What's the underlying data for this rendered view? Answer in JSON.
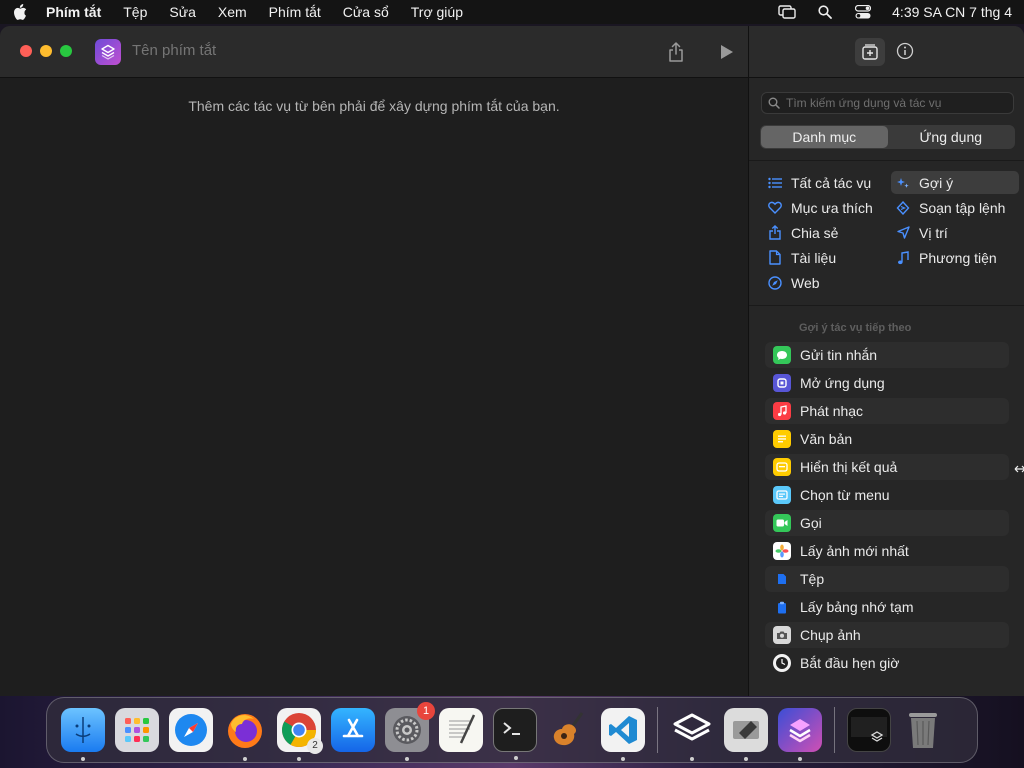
{
  "menubar": {
    "app_name": "Phím tắt",
    "items": [
      "Tệp",
      "Sửa",
      "Xem",
      "Phím tắt",
      "Cửa sổ",
      "Trợ giúp"
    ],
    "clock": "4:39 SA CN 7 thg 4"
  },
  "editor": {
    "title_placeholder": "Tên phím tắt",
    "hint": "Thêm các tác vụ từ bên phải để xây dựng phím tắt của bạn."
  },
  "sidebar": {
    "search_placeholder": "Tìm kiếm ứng dụng và tác vụ",
    "segments": [
      "Danh mục",
      "Ứng dụng"
    ],
    "categories_left": [
      {
        "label": "Tất cả tác vụ",
        "icon": "list-icon",
        "color": "#4a90ff"
      },
      {
        "label": "Mục ưa thích",
        "icon": "heart-icon",
        "color": "#4a90ff"
      },
      {
        "label": "Chia sẻ",
        "icon": "share-icon",
        "color": "#4a90ff"
      },
      {
        "label": "Tài liệu",
        "icon": "document-icon",
        "color": "#4a90ff"
      },
      {
        "label": "Web",
        "icon": "compass-icon",
        "color": "#4a90ff"
      }
    ],
    "categories_right": [
      {
        "label": "Gợi ý",
        "icon": "sparkle-icon",
        "color": "#4a90ff"
      },
      {
        "label": "Soạn tập lệnh",
        "icon": "script-icon",
        "color": "#4a90ff"
      },
      {
        "label": "Vị trí",
        "icon": "location-icon",
        "color": "#4a90ff"
      },
      {
        "label": "Phương tiện",
        "icon": "music-note-icon",
        "color": "#4a90ff"
      }
    ],
    "section_title": "Gợi ý tác vụ tiếp theo",
    "actions": [
      {
        "label": "Gửi tin nhắn",
        "icon": "messages-icon",
        "color": "#34c759"
      },
      {
        "label": "Mở ứng dụng",
        "icon": "app-icon",
        "color": "#5856d6"
      },
      {
        "label": "Phát nhạc",
        "icon": "music-icon",
        "color": "#fc3c44"
      },
      {
        "label": "Văn bản",
        "icon": "text-icon",
        "color": "#ffcc00"
      },
      {
        "label": "Hiển thị kết quả",
        "icon": "result-icon",
        "color": "#ffcc00"
      },
      {
        "label": "Chọn từ menu",
        "icon": "menu-icon",
        "color": "#5ac8fa"
      },
      {
        "label": "Gọi",
        "icon": "facetime-icon",
        "color": "#34c759"
      },
      {
        "label": "Lấy ảnh mới nhất",
        "icon": "photos-icon",
        "color": "#ffffff"
      },
      {
        "label": "Tệp",
        "icon": "file-icon",
        "color": "#1e6ff0"
      },
      {
        "label": "Lấy bảng nhớ tạm",
        "icon": "clipboard-icon",
        "color": "#1e6ff0"
      },
      {
        "label": "Chụp ảnh",
        "icon": "camera-icon",
        "color": "#8e8e93"
      },
      {
        "label": "Bắt đầu hẹn giờ",
        "icon": "clock-icon",
        "color": "#ffffff"
      }
    ]
  },
  "dock": {
    "settings_badge": "1",
    "chrome_badge": "2"
  }
}
